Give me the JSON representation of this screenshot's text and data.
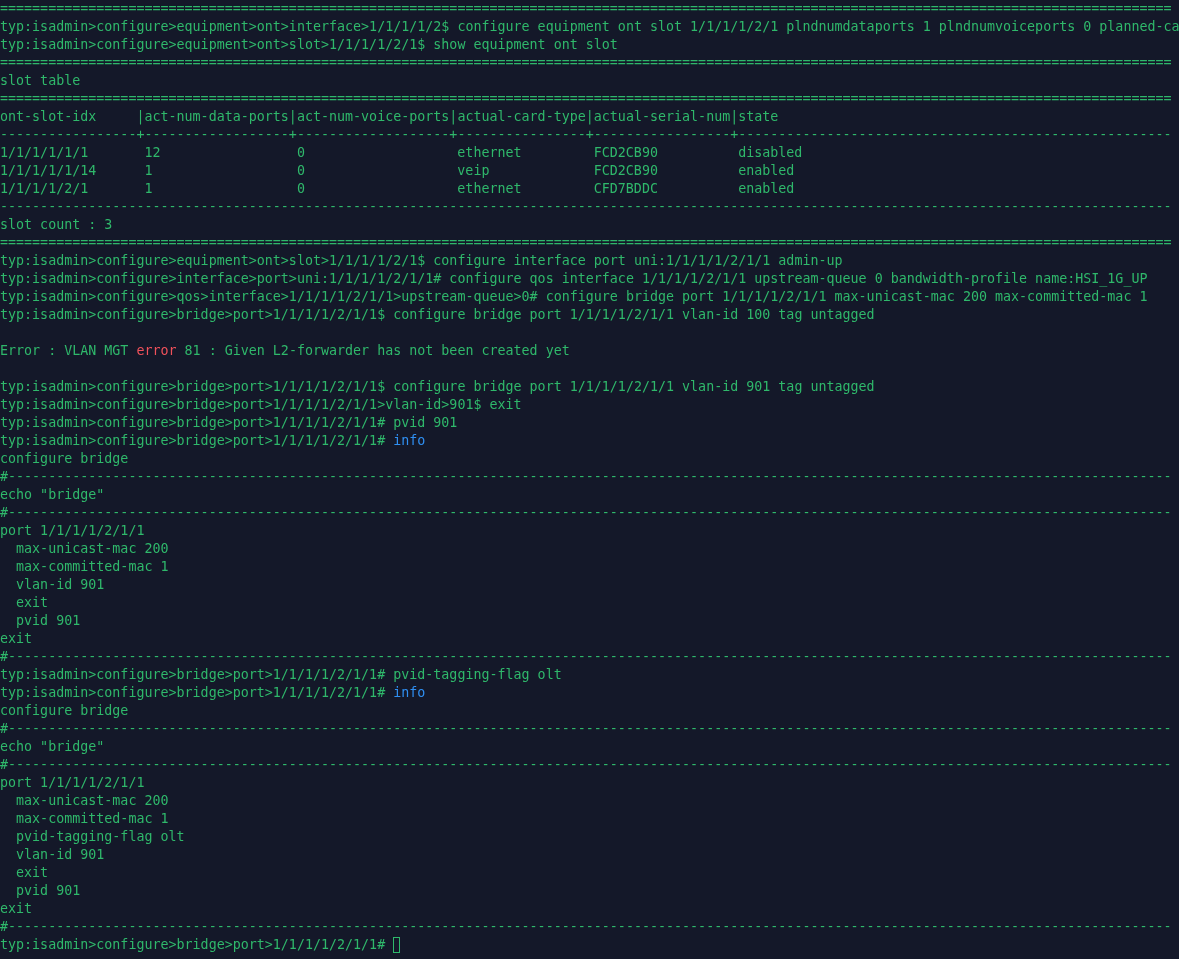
{
  "terminal": {
    "lines": [
      {
        "kind": "text",
        "text": "=================================================================================================================================================="
      },
      {
        "kind": "text",
        "text": "typ:isadmin>configure>equipment>ont>interface>1/1/1/1/2$ configure equipment ont slot 1/1/1/1/2/1 plndnumdataports 1 plndnumvoiceports 0 planned-ca"
      },
      {
        "kind": "text",
        "text": "typ:isadmin>configure>equipment>ont>slot>1/1/1/1/2/1$ show equipment ont slot"
      },
      {
        "kind": "text",
        "text": "=================================================================================================================================================="
      },
      {
        "kind": "text",
        "text": "slot table"
      },
      {
        "kind": "text",
        "text": "=================================================================================================================================================="
      },
      {
        "kind": "text",
        "text": "ont-slot-idx     |act-num-data-ports|act-num-voice-ports|actual-card-type|actual-serial-num|state"
      },
      {
        "kind": "text",
        "text": "-----------------+------------------+-------------------+----------------+-----------------+------------------------------------------------------"
      },
      {
        "kind": "row",
        "cells": [
          "1/1/1/1/1/1",
          "12",
          "0",
          "ethernet",
          "FCD2CB90",
          "disabled"
        ]
      },
      {
        "kind": "row",
        "cells": [
          "1/1/1/1/1/14",
          "1",
          "0",
          "veip",
          "FCD2CB90",
          "enabled"
        ]
      },
      {
        "kind": "row",
        "cells": [
          "1/1/1/1/2/1",
          "1",
          "0",
          "ethernet",
          "CFD7BDDC",
          "enabled"
        ]
      },
      {
        "kind": "text",
        "text": "--------------------------------------------------------------------------------------------------------------------------------------------------"
      },
      {
        "kind": "text",
        "text": "slot count : 3"
      },
      {
        "kind": "text",
        "text": "=================================================================================================================================================="
      },
      {
        "kind": "text",
        "text": "typ:isadmin>configure>equipment>ont>slot>1/1/1/1/2/1$ configure interface port uni:1/1/1/1/2/1/1 admin-up"
      },
      {
        "kind": "text",
        "text": "typ:isadmin>configure>interface>port>uni:1/1/1/1/2/1/1# configure qos interface 1/1/1/1/2/1/1 upstream-queue 0 bandwidth-profile name:HSI_1G_UP"
      },
      {
        "kind": "text",
        "text": "typ:isadmin>configure>qos>interface>1/1/1/1/2/1/1>upstream-queue>0# configure bridge port 1/1/1/1/2/1/1 max-unicast-mac 200 max-committed-mac 1"
      },
      {
        "kind": "text",
        "text": "typ:isadmin>configure>bridge>port>1/1/1/1/2/1/1$ configure bridge port 1/1/1/1/2/1/1 vlan-id 100 tag untagged"
      },
      {
        "kind": "blank"
      },
      {
        "kind": "styled",
        "segments": [
          {
            "kind": "plain",
            "text": "Error : VLAN MGT "
          },
          {
            "kind": "error",
            "text": "error"
          },
          {
            "kind": "plain",
            "text": " 81 : Given L2-forwarder has not been created yet"
          }
        ]
      },
      {
        "kind": "blank"
      },
      {
        "kind": "text",
        "text": "typ:isadmin>configure>bridge>port>1/1/1/1/2/1/1$ configure bridge port 1/1/1/1/2/1/1 vlan-id 901 tag untagged"
      },
      {
        "kind": "text",
        "text": "typ:isadmin>configure>bridge>port>1/1/1/1/2/1/1>vlan-id>901$ exit"
      },
      {
        "kind": "text",
        "text": "typ:isadmin>configure>bridge>port>1/1/1/1/2/1/1# pvid 901"
      },
      {
        "kind": "styled",
        "segments": [
          {
            "kind": "plain",
            "text": "typ:isadmin>configure>bridge>port>1/1/1/1/2/1/1# "
          },
          {
            "kind": "command",
            "text": "info"
          }
        ]
      },
      {
        "kind": "text",
        "text": "configure bridge"
      },
      {
        "kind": "text",
        "text": "#-------------------------------------------------------------------------------------------------------------------------------------------------"
      },
      {
        "kind": "text",
        "text": "echo \"bridge\""
      },
      {
        "kind": "text",
        "text": "#-------------------------------------------------------------------------------------------------------------------------------------------------"
      },
      {
        "kind": "text",
        "text": "port 1/1/1/1/2/1/1"
      },
      {
        "kind": "text",
        "text": "  max-unicast-mac 200"
      },
      {
        "kind": "text",
        "text": "  max-committed-mac 1"
      },
      {
        "kind": "text",
        "text": "  vlan-id 901"
      },
      {
        "kind": "text",
        "text": "  exit"
      },
      {
        "kind": "text",
        "text": "  pvid 901"
      },
      {
        "kind": "text",
        "text": "exit"
      },
      {
        "kind": "text",
        "text": "#-------------------------------------------------------------------------------------------------------------------------------------------------"
      },
      {
        "kind": "text",
        "text": "typ:isadmin>configure>bridge>port>1/1/1/1/2/1/1# pvid-tagging-flag olt"
      },
      {
        "kind": "styled",
        "segments": [
          {
            "kind": "plain",
            "text": "typ:isadmin>configure>bridge>port>1/1/1/1/2/1/1# "
          },
          {
            "kind": "command",
            "text": "info"
          }
        ]
      },
      {
        "kind": "text",
        "text": "configure bridge"
      },
      {
        "kind": "text",
        "text": "#-------------------------------------------------------------------------------------------------------------------------------------------------"
      },
      {
        "kind": "text",
        "text": "echo \"bridge\""
      },
      {
        "kind": "text",
        "text": "#-------------------------------------------------------------------------------------------------------------------------------------------------"
      },
      {
        "kind": "text",
        "text": "port 1/1/1/1/2/1/1"
      },
      {
        "kind": "text",
        "text": "  max-unicast-mac 200"
      },
      {
        "kind": "text",
        "text": "  max-committed-mac 1"
      },
      {
        "kind": "text",
        "text": "  pvid-tagging-flag olt"
      },
      {
        "kind": "text",
        "text": "  vlan-id 901"
      },
      {
        "kind": "text",
        "text": "  exit"
      },
      {
        "kind": "text",
        "text": "  pvid 901"
      },
      {
        "kind": "text",
        "text": "exit"
      },
      {
        "kind": "text",
        "text": "#-------------------------------------------------------------------------------------------------------------------------------------------------"
      },
      {
        "kind": "prompt",
        "text": "typ:isadmin>configure>bridge>port>1/1/1/1/2/1/1# ",
        "cursor": true
      }
    ]
  }
}
